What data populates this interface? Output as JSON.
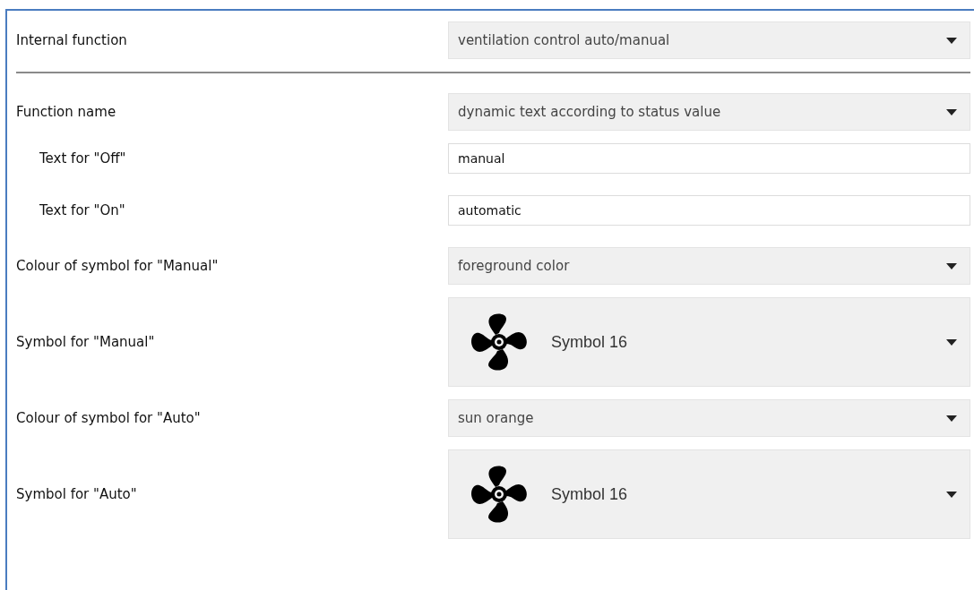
{
  "rows": [
    {
      "kind": "select",
      "label": "Internal function",
      "indented": false,
      "value": "ventilation control auto/manual"
    },
    {
      "kind": "divider"
    },
    {
      "kind": "select",
      "label": "Function name",
      "indented": false,
      "value": "dynamic text according to status value"
    },
    {
      "kind": "text",
      "label": "Text for \"Off\"",
      "indented": true,
      "value": "manual"
    },
    {
      "kind": "text",
      "label": "Text for \"On\"",
      "indented": true,
      "value": "automatic"
    },
    {
      "kind": "select",
      "label": "Colour of symbol for \"Manual\"",
      "indented": false,
      "value": "foreground color"
    },
    {
      "kind": "symbol",
      "label": "Symbol for \"Manual\"",
      "indented": false,
      "value": "Symbol 16"
    },
    {
      "kind": "select",
      "label": "Colour of symbol for \"Auto\"",
      "indented": false,
      "value": "sun orange"
    },
    {
      "kind": "symbol",
      "label": "Symbol for \"Auto\"",
      "indented": false,
      "value": "Symbol 16"
    }
  ]
}
